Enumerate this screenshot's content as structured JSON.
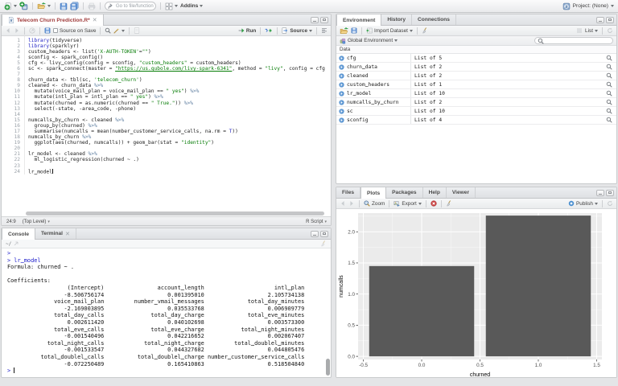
{
  "main_toolbar": {
    "goto_placeholder": "Go to file/function",
    "addins_label": "Addins",
    "project_label": "Project: (None)"
  },
  "editor": {
    "tab_title": "Telecom Churn Prediction.R*",
    "source_on_save_label": "Source on Save",
    "run_label": "Run",
    "source_label": "Source",
    "code_lines": [
      "library(tidyverse)",
      "library(sparklyr)",
      "custom_headers <- list('X-AUTH-TOKEN'=\"\")",
      "sconfig <- spark_config()",
      "cfg <- livy_config(config = sconfig, \"custom_headers\" = custom_headers)",
      "sc <- spark_connect(master = \"https://us.qubole.com/livy-spark-6341\", method = \"livy\", config = cfg",
      "",
      "churn_data <- tbl(sc, 'telecom_churn')",
      "cleaned <- churn_data %>%",
      "  mutate(voice_mail_plan = voice_mail_plan == \" yes\") %>%",
      "  mutate(intl_plan = intl_plan == \" yes\") %>%",
      "  mutate(churned = as.numeric(churned == \" True.\")) %>%",
      "  select(-state, -area_code, -phone)",
      "",
      "numcalls_by_churn <- cleaned %>%",
      "  group_by(churned) %>%",
      "  summarise(numcalls = mean(number_customer_service_calls, na.rm = T))",
      "numcalls_by_churn %>%",
      "  ggplot(aes(churned, numcalls)) + geom_bar(stat = \"identity\")",
      "",
      "lr_model <- cleaned %>%",
      "  ml_logistic_regression(churned ~ .)",
      "",
      "lr_model"
    ],
    "cursor_line": 24,
    "status": {
      "position": "24:9",
      "scope": "(Top Level)",
      "file_type": "R Script"
    }
  },
  "console": {
    "tab_console": "Console",
    "tab_terminal": "Terminal",
    "path": "~/",
    "pre_lines": [
      ">",
      "> lr_model",
      "Formula: churned ~ .",
      "",
      "Coefficients:"
    ],
    "coefficients": [
      {
        "labels": [
          "(Intercept)",
          "account_length",
          "intl_plan"
        ],
        "values": [
          "-8.506756174",
          "0.001395010",
          "2.105734138"
        ]
      },
      {
        "labels": [
          "voice_mail_plan",
          "number_vmail_messages",
          "total_day_minutes"
        ],
        "values": [
          "-2.169003895",
          "0.035533768",
          "0.006909779"
        ]
      },
      {
        "labels": [
          "total_day_calls",
          "total_day_charge",
          "total_eve_minutes"
        ],
        "values": [
          "0.002611420",
          "0.040102698",
          "0.003573300"
        ]
      },
      {
        "labels": [
          "total_eve_calls",
          "total_eve_charge",
          "total_night_minutes"
        ],
        "values": [
          "-0.001540496",
          "0.042216652",
          "0.002067407"
        ]
      },
      {
        "labels": [
          "total_night_calls",
          "total_night_charge",
          "total_doublel_minutes"
        ],
        "values": [
          "-0.001533547",
          "0.044327682",
          "0.044805476"
        ]
      },
      {
        "labels": [
          "total_doublel_calls",
          "total_doublel_charge",
          "number_customer_service_calls"
        ],
        "values": [
          "-0.072250489",
          "0.165410863",
          "0.518504840"
        ]
      }
    ],
    "field_width": 29,
    "final_prompt": "> "
  },
  "environment": {
    "tabs": [
      "Environment",
      "History",
      "Connections"
    ],
    "import_label": "Import Dataset",
    "list_label": "List",
    "scope_label": "Global Environment",
    "section_label": "Data",
    "objects": [
      {
        "name": "cfg",
        "value": "List of 5"
      },
      {
        "name": "churn_data",
        "value": "List of 2"
      },
      {
        "name": "cleaned",
        "value": "List of 2"
      },
      {
        "name": "custom_headers",
        "value": "List of 1"
      },
      {
        "name": "lr_model",
        "value": "List of 10"
      },
      {
        "name": "numcalls_by_churn",
        "value": "List of 2"
      },
      {
        "name": "sc",
        "value": "List of 10"
      },
      {
        "name": "sconfig",
        "value": "List of 4"
      }
    ]
  },
  "plots": {
    "tabs": [
      "Files",
      "Plots",
      "Packages",
      "Help",
      "Viewer"
    ],
    "zoom_label": "Zoom",
    "export_label": "Export",
    "publish_label": "Publish"
  },
  "chart_data": {
    "type": "bar",
    "title": "",
    "xlabel": "churned",
    "ylabel": "numcalls",
    "categories": [
      0,
      1
    ],
    "values": [
      1.45,
      2.26
    ],
    "bar_width": 0.9,
    "x_ticks": [
      -0.5,
      0.0,
      0.5,
      1.0,
      1.5
    ],
    "y_ticks": [
      0.0,
      0.5,
      1.0,
      1.5,
      2.0
    ],
    "xlim": [
      -0.545,
      1.545
    ],
    "ylim": [
      -0.05,
      2.3
    ],
    "panel_bg": "#EBEBEB",
    "grid_color": "#FFFFFF",
    "bar_color": "#595959",
    "tick_label_color": "#4D4D4D"
  }
}
